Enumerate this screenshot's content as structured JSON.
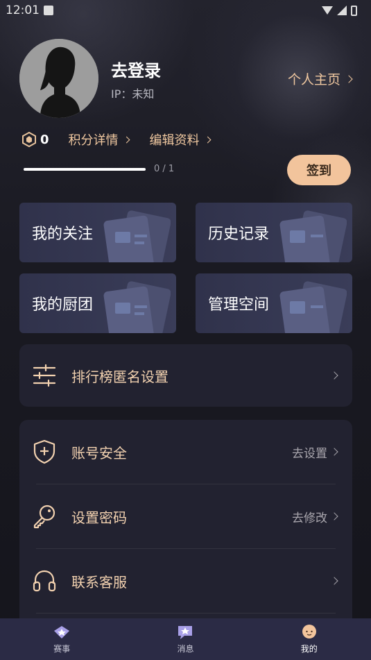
{
  "status": {
    "time": "12:01"
  },
  "profile": {
    "username": "去登录",
    "ip": "IP：未知",
    "homepage_label": "个人主页"
  },
  "points": {
    "value": "0",
    "details_label": "积分详情",
    "edit_label": "编辑资料"
  },
  "progress": {
    "text": "0 / 1",
    "fraction": 0
  },
  "checkin_label": "签到",
  "cards": [
    {
      "label": "我的关注"
    },
    {
      "label": "历史记录"
    },
    {
      "label": "我的厨团"
    },
    {
      "label": "管理空间"
    }
  ],
  "settings": {
    "leaderboard": {
      "label": "排行榜匿名设置"
    },
    "account_security": {
      "label": "账号安全",
      "action": "去设置"
    },
    "password": {
      "label": "设置密码",
      "action": "去修改"
    },
    "support": {
      "label": "联系客服"
    }
  },
  "tabs": [
    {
      "label": "赛事",
      "icon": "trophy-diamond-icon"
    },
    {
      "label": "消息",
      "icon": "message-star-icon"
    },
    {
      "label": "我的",
      "icon": "profile-face-icon"
    }
  ],
  "colors": {
    "accent": "#f2c49c",
    "label_gold": "#f3d2b0",
    "tabbar": "#2b2b45",
    "card": "#34364f"
  }
}
